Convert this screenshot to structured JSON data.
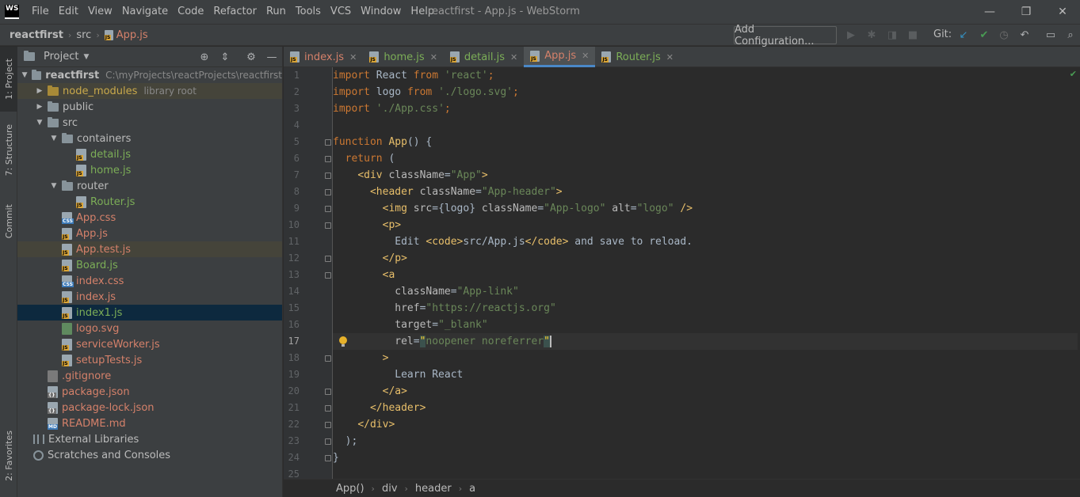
{
  "window": {
    "logo_text": "WS",
    "title": "reactfirst - App.js - WebStorm",
    "minimize": "—",
    "maximize": "❐",
    "close": "✕"
  },
  "menu": [
    "File",
    "Edit",
    "View",
    "Navigate",
    "Code",
    "Refactor",
    "Run",
    "Tools",
    "VCS",
    "Window",
    "Help"
  ],
  "navbar": {
    "breadcrumb": [
      "reactfirst",
      "src",
      "App.js"
    ],
    "add_configuration": "Add Configuration...",
    "git_label": "Git:"
  },
  "left_strip": {
    "project": "1: Project",
    "structure": "7: Structure",
    "commit": "Commit",
    "favorites": "2: Favorites"
  },
  "project_panel": {
    "title": "Project",
    "tree": [
      {
        "label": "reactfirst",
        "hint": "C:\\myProjects\\reactProjects\\reactfirst",
        "kind": "folder",
        "depth": 0,
        "arrow": "▼",
        "color": "default",
        "bold": true
      },
      {
        "label": "node_modules",
        "hint": "library root",
        "kind": "folder-excluded",
        "depth": 1,
        "arrow": "▶",
        "color": "ignored",
        "state": "hl"
      },
      {
        "label": "public",
        "kind": "folder",
        "depth": 1,
        "arrow": "▶",
        "color": "default"
      },
      {
        "label": "src",
        "kind": "folder",
        "depth": 1,
        "arrow": "▼",
        "color": "default"
      },
      {
        "label": "containers",
        "kind": "folder",
        "depth": 2,
        "arrow": "▼",
        "color": "default"
      },
      {
        "label": "detail.js",
        "kind": "js",
        "depth": 3,
        "color": "green"
      },
      {
        "label": "home.js",
        "kind": "js",
        "depth": 3,
        "color": "green"
      },
      {
        "label": "router",
        "kind": "folder",
        "depth": 2,
        "arrow": "▼",
        "color": "default"
      },
      {
        "label": "Router.js",
        "kind": "js",
        "depth": 3,
        "color": "green"
      },
      {
        "label": "App.css",
        "kind": "css",
        "depth": 2,
        "color": "red"
      },
      {
        "label": "App.js",
        "kind": "js",
        "depth": 2,
        "color": "red"
      },
      {
        "label": "App.test.js",
        "kind": "js",
        "depth": 2,
        "color": "red",
        "state": "hl"
      },
      {
        "label": "Board.js",
        "kind": "js",
        "depth": 2,
        "color": "green"
      },
      {
        "label": "index.css",
        "kind": "css",
        "depth": 2,
        "color": "red"
      },
      {
        "label": "index.js",
        "kind": "js",
        "depth": 2,
        "color": "red"
      },
      {
        "label": "index1.js",
        "kind": "js",
        "depth": 2,
        "color": "green",
        "state": "sel"
      },
      {
        "label": "logo.svg",
        "kind": "svg",
        "depth": 2,
        "color": "red"
      },
      {
        "label": "serviceWorker.js",
        "kind": "js",
        "depth": 2,
        "color": "red"
      },
      {
        "label": "setupTests.js",
        "kind": "js",
        "depth": 2,
        "color": "red"
      },
      {
        "label": ".gitignore",
        "kind": "git",
        "depth": 1,
        "color": "red"
      },
      {
        "label": "package.json",
        "kind": "json",
        "depth": 1,
        "color": "red"
      },
      {
        "label": "package-lock.json",
        "kind": "json",
        "depth": 1,
        "color": "red"
      },
      {
        "label": "README.md",
        "kind": "md",
        "depth": 1,
        "color": "red"
      },
      {
        "label": "External Libraries",
        "kind": "lib",
        "depth": 0,
        "color": "default"
      },
      {
        "label": "Scratches and Consoles",
        "kind": "scratch",
        "depth": 0,
        "color": "default"
      }
    ]
  },
  "tabs": [
    {
      "label": "index.js",
      "color": "red",
      "active": false
    },
    {
      "label": "home.js",
      "color": "green",
      "active": false
    },
    {
      "label": "detail.js",
      "color": "green",
      "active": false
    },
    {
      "label": "App.js",
      "color": "red",
      "active": true
    },
    {
      "label": "Router.js",
      "color": "green",
      "active": false
    }
  ],
  "editor": {
    "current_line": 17,
    "line_numbers": [
      "1",
      "2",
      "3",
      "4",
      "5",
      "6",
      "7",
      "8",
      "9",
      "10",
      "11",
      "12",
      "13",
      "14",
      "15",
      "16",
      "17",
      "18",
      "19",
      "20",
      "21",
      "22",
      "23",
      "24",
      "25"
    ],
    "lines": [
      [
        [
          "kw",
          "import"
        ],
        [
          "plain",
          " React "
        ],
        [
          "kw",
          "from"
        ],
        [
          "plain",
          " "
        ],
        [
          "str",
          "'react'"
        ],
        [
          "kw",
          ";"
        ]
      ],
      [
        [
          "kw",
          "import"
        ],
        [
          "plain",
          " logo "
        ],
        [
          "kw",
          "from"
        ],
        [
          "plain",
          " "
        ],
        [
          "str",
          "'./logo.svg'"
        ],
        [
          "kw",
          ";"
        ]
      ],
      [
        [
          "kw",
          "import"
        ],
        [
          "plain",
          " "
        ],
        [
          "str",
          "'./App.css'"
        ],
        [
          "kw",
          ";"
        ]
      ],
      [],
      [
        [
          "kw",
          "function"
        ],
        [
          "plain",
          " "
        ],
        [
          "tag",
          "App"
        ],
        [
          "plain",
          "() {"
        ]
      ],
      [
        [
          "plain",
          "  "
        ],
        [
          "kw",
          "return"
        ],
        [
          "plain",
          " ("
        ]
      ],
      [
        [
          "plain",
          "    "
        ],
        [
          "tag",
          "<div"
        ],
        [
          "attr",
          " className"
        ],
        [
          "plain",
          "="
        ],
        [
          "str",
          "\"App\""
        ],
        [
          "tag",
          ">"
        ]
      ],
      [
        [
          "plain",
          "      "
        ],
        [
          "tag",
          "<header"
        ],
        [
          "attr",
          " className"
        ],
        [
          "plain",
          "="
        ],
        [
          "str",
          "\"App-header\""
        ],
        [
          "tag",
          ">"
        ]
      ],
      [
        [
          "plain",
          "        "
        ],
        [
          "tag",
          "<img"
        ],
        [
          "attr",
          " src"
        ],
        [
          "plain",
          "={logo} "
        ],
        [
          "attr",
          "className"
        ],
        [
          "plain",
          "="
        ],
        [
          "str",
          "\"App-logo\""
        ],
        [
          "attr",
          " alt"
        ],
        [
          "plain",
          "="
        ],
        [
          "str",
          "\"logo\""
        ],
        [
          "tag",
          " />"
        ]
      ],
      [
        [
          "plain",
          "        "
        ],
        [
          "tag",
          "<p>"
        ]
      ],
      [
        [
          "plain",
          "          Edit "
        ],
        [
          "tag",
          "<code>"
        ],
        [
          "plain",
          "src/App.js"
        ],
        [
          "tag",
          "</code>"
        ],
        [
          "plain",
          " and save to reload."
        ]
      ],
      [
        [
          "plain",
          "        "
        ],
        [
          "tag",
          "</p>"
        ]
      ],
      [
        [
          "plain",
          "        "
        ],
        [
          "tag",
          "<a"
        ]
      ],
      [
        [
          "plain",
          "          "
        ],
        [
          "attr",
          "className"
        ],
        [
          "plain",
          "="
        ],
        [
          "str",
          "\"App-link\""
        ]
      ],
      [
        [
          "plain",
          "          "
        ],
        [
          "attr",
          "href"
        ],
        [
          "plain",
          "="
        ],
        [
          "str",
          "\"https://reactjs.org\""
        ]
      ],
      [
        [
          "plain",
          "          "
        ],
        [
          "attr",
          "target"
        ],
        [
          "plain",
          "="
        ],
        [
          "str",
          "\"_blank\""
        ]
      ],
      [
        [
          "plain",
          "          "
        ],
        [
          "attr",
          "rel"
        ],
        [
          "plain",
          "="
        ],
        [
          "quote",
          "\""
        ],
        [
          "str",
          "noopener noreferrer"
        ],
        [
          "quote",
          "\""
        ],
        [
          "caret",
          ""
        ]
      ],
      [
        [
          "plain",
          "        "
        ],
        [
          "tag",
          ">"
        ]
      ],
      [
        [
          "plain",
          "          Learn React"
        ]
      ],
      [
        [
          "plain",
          "        "
        ],
        [
          "tag",
          "</a>"
        ]
      ],
      [
        [
          "plain",
          "      "
        ],
        [
          "tag",
          "</header>"
        ]
      ],
      [
        [
          "plain",
          "    "
        ],
        [
          "tag",
          "</div>"
        ]
      ],
      [
        [
          "plain",
          "  );"
        ]
      ],
      [
        [
          "plain",
          "}"
        ]
      ],
      []
    ]
  },
  "code_breadcrumb": [
    "App()",
    "div",
    "header",
    "a"
  ],
  "colors": {
    "accent": "#4a88c7",
    "modified_file": "#d5816a",
    "new_file": "#7cae57"
  }
}
